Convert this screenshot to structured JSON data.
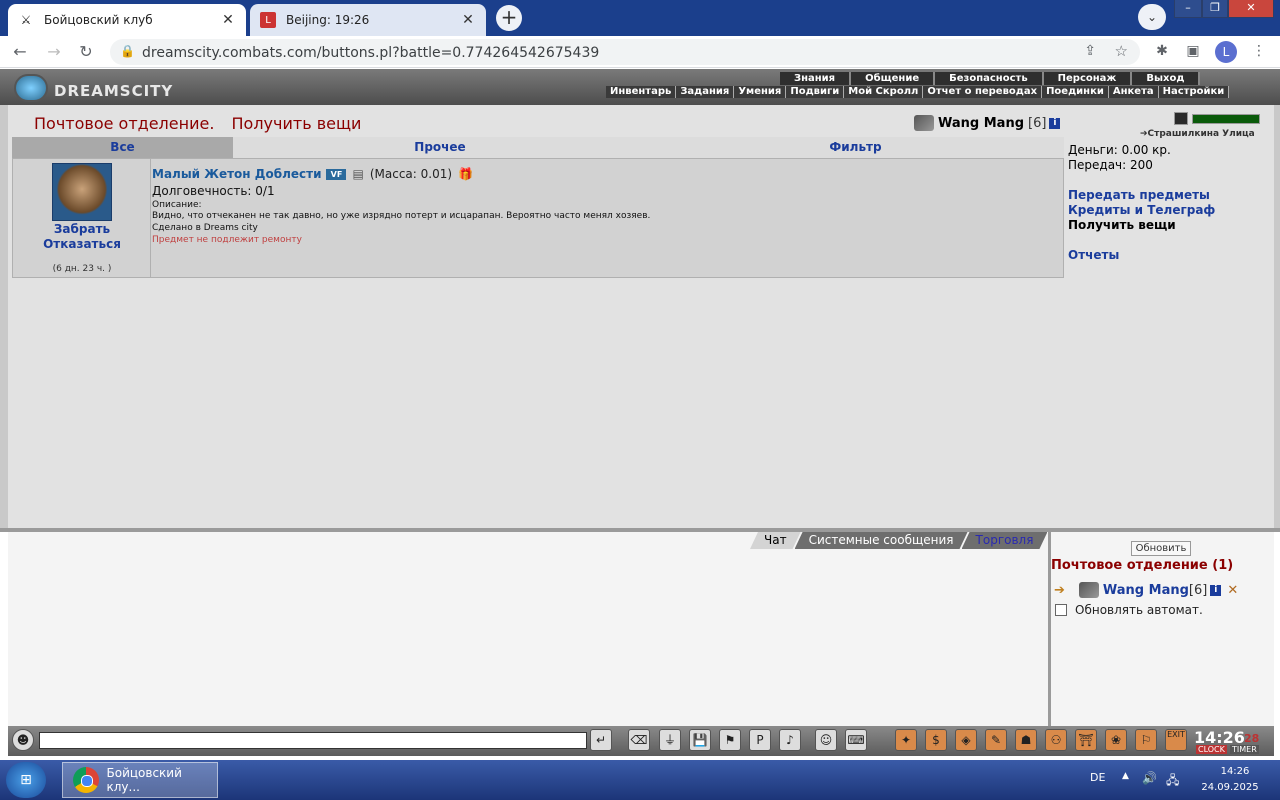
{
  "browser": {
    "tabs": [
      {
        "title": "Бойцовский клуб",
        "icon": "crossed-swords-icon",
        "active": true
      },
      {
        "title": "Beijing: 19:26",
        "icon": "clock-favicon",
        "active": false
      }
    ],
    "new_tab": "+",
    "url": "dreamscity.combats.com/buttons.pl?battle=0.774264542675439",
    "profile_initial": "L"
  },
  "game": {
    "logo": "DREAMSCITY",
    "top_menu": [
      "Знания",
      "Общение",
      "Безопасность",
      "Персонаж",
      "Выход"
    ],
    "sub_menu": [
      "Инвентарь",
      "Задания",
      "Умения",
      "Подвиги",
      "Мой Скролл",
      "Отчет о переводах",
      "Поединки",
      "Анкета",
      "Настройки"
    ]
  },
  "page": {
    "title_left": "Почтовое отделение.",
    "title_right": "Получить вещи",
    "user": {
      "name": "Wang Mang",
      "level": "[6]",
      "info": "i"
    },
    "street": "➔Страшилкина Улица",
    "tabs": [
      "Все",
      "Прочее",
      "Фильтр"
    ]
  },
  "item": {
    "take": "Забрать",
    "refuse": "Отказаться",
    "time_left": "(6 дн. 23 ч. )",
    "name": "Малый Жетон Доблести",
    "badge": "VF",
    "mass": "(Масса: 0.01)",
    "durability": "Долговечность: 0/1",
    "desc_label": "Описание:",
    "description": "Видно, что отчеканен не так давно, но уже изрядно потерт и исцарапан. Вероятно часто менял хозяев.",
    "made_in": "Сделано в Dreams city",
    "no_repair": "Предмет не подлежит ремонту"
  },
  "sidebar": {
    "money": "Деньги: 0.00 кр.",
    "transfers": "Передач: 200",
    "links": [
      "Передать предметы",
      "Кредиты и Телеграф",
      "Получить вещи",
      "Отчеты"
    ]
  },
  "chat": {
    "tabs": [
      "Чат",
      "Системные сообщения",
      "Торговля"
    ],
    "refresh": "Обновить",
    "room": "Почтовое отделение (1)",
    "online_user": {
      "name": "Wang Mang",
      "level": "[6]",
      "info": "i"
    },
    "auto_refresh": "Обновлять автомат."
  },
  "toolbar": {
    "clock": "14:26",
    "seconds": "28",
    "clock_label": "CLOCK",
    "timer_label": "TIMER",
    "exit_label": "EXIT"
  },
  "taskbar": {
    "app_label": "Бойцовский клу...",
    "lang": "DE",
    "time": "14:26",
    "date": "24.09.2025"
  }
}
